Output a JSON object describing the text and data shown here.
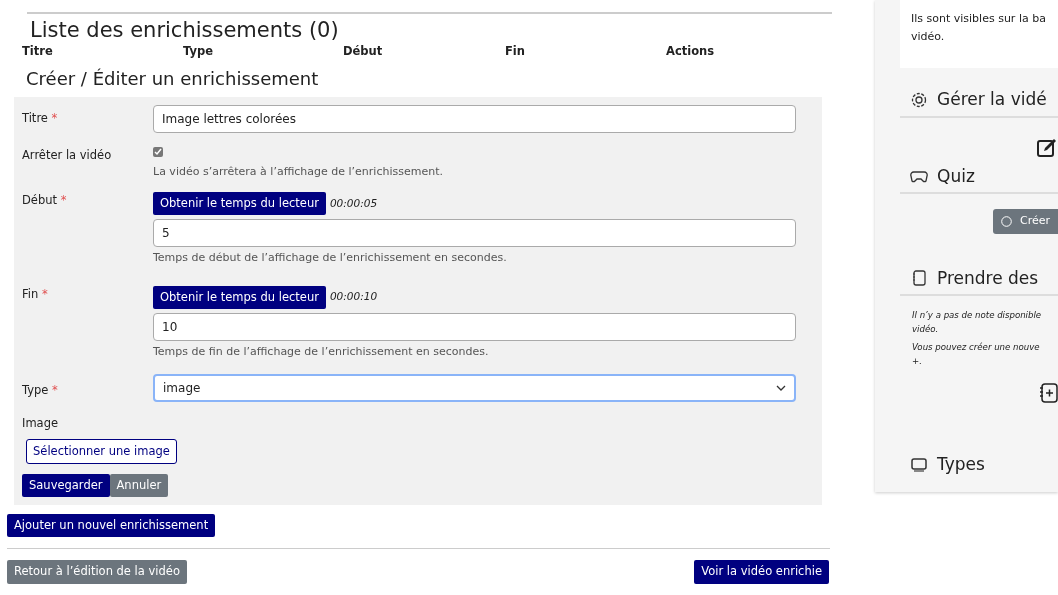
{
  "list": {
    "title": "Liste des enrichissements (0)",
    "columns": [
      "Titre",
      "Type",
      "Début",
      "Fin",
      "Actions"
    ]
  },
  "form": {
    "title": "Créer / Éditer un enrichissement",
    "fields": [
      {
        "kind": "text",
        "label": "Titre",
        "required_mark": "*",
        "value": "Image lettres colorées"
      },
      {
        "kind": "checkbox",
        "label": "Arrêter la vidéo",
        "checked": true,
        "help": "La vidéo s’arrêtera à l’affichage de l’enrichissement."
      },
      {
        "kind": "time",
        "label": "Début",
        "required_mark": "*",
        "button": "Obtenir le temps du lecteur",
        "time": "00:00:05",
        "value": "5",
        "help": "Temps de début de l’affichage de l’enrichissement en secondes."
      },
      {
        "kind": "time",
        "label": "Fin",
        "required_mark": "*",
        "button": "Obtenir le temps du lecteur",
        "time": "00:00:10",
        "value": "10",
        "help": "Temps de fin de l’affichage de l’enrichissement en secondes."
      },
      {
        "kind": "select",
        "label": "Type",
        "required_mark": "*",
        "value": "image"
      },
      {
        "kind": "image",
        "label": "Image",
        "button": "Sélectionner une image"
      }
    ],
    "save": "Sauvegarder",
    "cancel": "Annuler"
  },
  "add_button": "Ajouter un nouvel enrichissement",
  "back_button": "Retour à l’édition de la vidéo",
  "view_button": "Voir la vidéo enrichie",
  "sidebar": {
    "info": [
      "Ils sont visibles sur la ba",
      "vidéo."
    ],
    "manage": {
      "title": "Gérer la vidé"
    },
    "quiz": {
      "title": "Quiz",
      "button": "Créer"
    },
    "notes": {
      "title": "Prendre des",
      "lines": [
        "Il n’y a pas de note disponible",
        "vidéo.",
        "Vous pouvez créer une nouve",
        "+."
      ]
    },
    "types": {
      "title": "Types"
    }
  }
}
